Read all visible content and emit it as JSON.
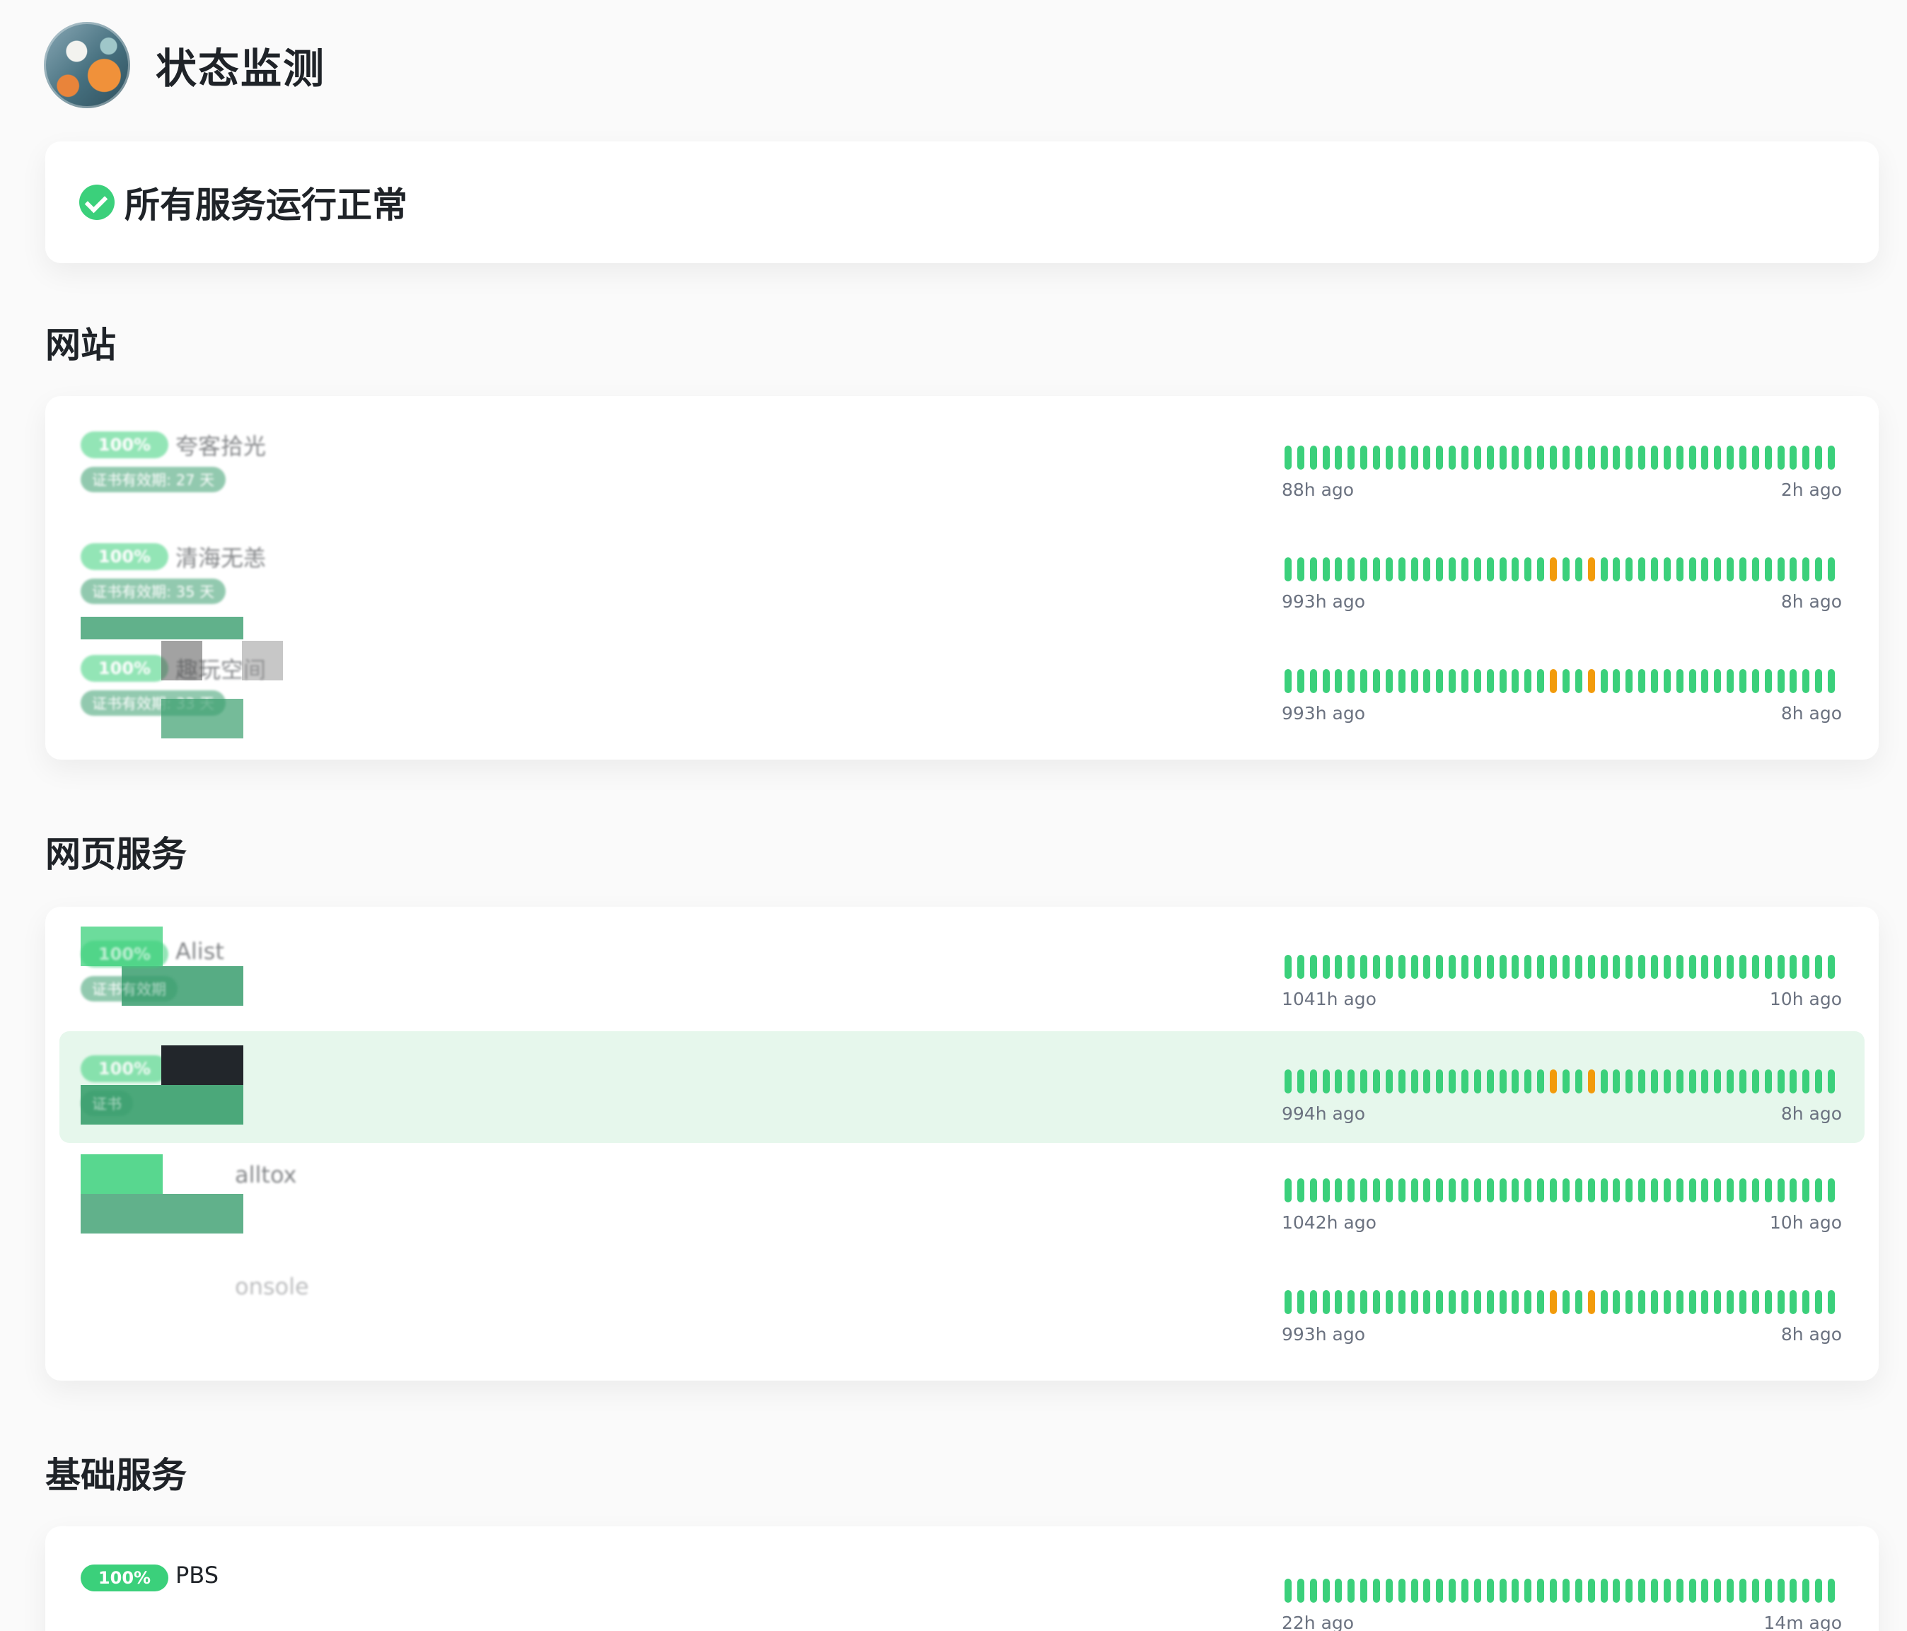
{
  "header": {
    "title": "状态监测",
    "logo_icon": "avatar-image"
  },
  "banner": {
    "text": "所有服务运行正常",
    "icon": "check-circle-icon"
  },
  "colors": {
    "ok": "#3bd07b",
    "warn": "#f29b0b",
    "cert": "#3a9e6e",
    "highlight": "#e6f7ec"
  },
  "sections": [
    {
      "title": "网站",
      "services": [
        {
          "pct": "100%",
          "name": "夸客拾光",
          "cert": "证书有效期: 27 天",
          "warn": [],
          "start": "88h ago",
          "end": "2h ago"
        },
        {
          "pct": "100%",
          "name": "清海无恙",
          "cert": "证书有效期: 35 天",
          "warn": [
            21,
            24
          ],
          "start": "993h ago",
          "end": "8h ago"
        },
        {
          "pct": "100%",
          "name": "趣玩空间",
          "cert": "证书有效期: 33 天",
          "warn": [
            21,
            24
          ],
          "start": "993h ago",
          "end": "8h ago"
        }
      ]
    },
    {
      "title": "网页服务",
      "services": [
        {
          "pct": "100%",
          "name": "Alist",
          "cert": "证书有效期",
          "warn": [],
          "start": "1041h ago",
          "end": "10h ago"
        },
        {
          "pct": "100%",
          "name": "",
          "cert": "证书",
          "warn": [
            21,
            24
          ],
          "start": "994h ago",
          "end": "8h ago"
        },
        {
          "pct": "",
          "name": "alltox",
          "cert": "",
          "warn": [],
          "start": "1042h ago",
          "end": "10h ago"
        },
        {
          "pct": "",
          "name": "onsole",
          "cert": "",
          "warn": [
            21,
            24
          ],
          "start": "993h ago",
          "end": "8h ago"
        }
      ]
    },
    {
      "title": "基础服务",
      "services": [
        {
          "pct": "100%",
          "name": "PBS",
          "cert": "",
          "warn": [],
          "start": "22h ago",
          "end": "14m ago"
        }
      ]
    }
  ]
}
